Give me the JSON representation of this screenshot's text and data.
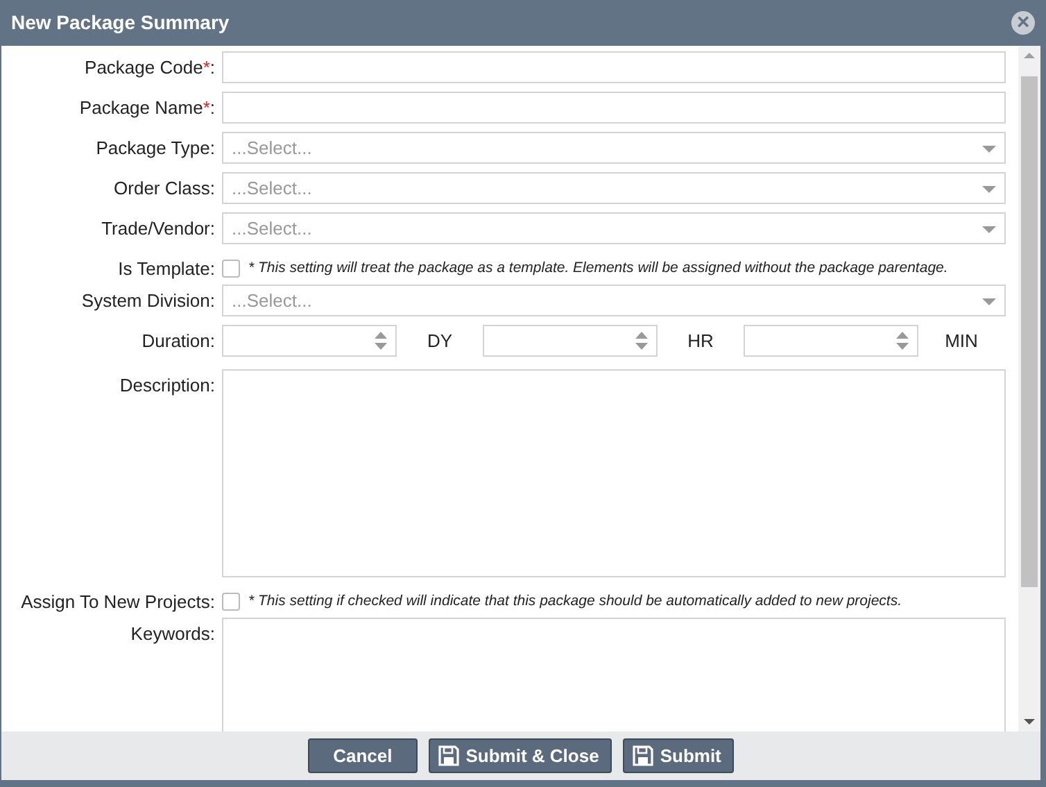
{
  "window": {
    "title": "New Package Summary",
    "close": "×"
  },
  "fields": [
    {
      "kind": "text",
      "label": "Package Code",
      "required_mark": "*",
      "label_end": ":"
    },
    {
      "kind": "text",
      "label": "Package Name",
      "required_mark": "*",
      "label_end": ":"
    },
    {
      "kind": "select",
      "label": "Package Type:",
      "placeholder": "...Select..."
    },
    {
      "kind": "select",
      "label": "Order Class:",
      "placeholder": "...Select..."
    },
    {
      "kind": "select",
      "label": "Trade/Vendor:",
      "placeholder": "...Select..."
    },
    {
      "kind": "checkbox",
      "label": "Is Template:",
      "checked": false,
      "note": "* This setting will treat the package as a template. Elements will be assigned without the package parentage."
    },
    {
      "kind": "select",
      "label": "System Division:",
      "placeholder": "...Select..."
    },
    {
      "kind": "duration",
      "label": "Duration:",
      "units": [
        "DY",
        "HR",
        "MIN"
      ]
    },
    {
      "kind": "textarea",
      "label": "Description:"
    },
    {
      "kind": "checkbox",
      "label": "Assign To New Projects:",
      "checked": false,
      "note": "* This setting if checked will indicate that this package should be automatically added to new projects."
    },
    {
      "kind": "short_textarea",
      "label": "Keywords:"
    }
  ],
  "buttons": [
    {
      "label": "Cancel",
      "kind": "plain"
    },
    {
      "label": "Submit & Close",
      "kind": "save"
    },
    {
      "label": "Submit",
      "kind": "save"
    }
  ]
}
